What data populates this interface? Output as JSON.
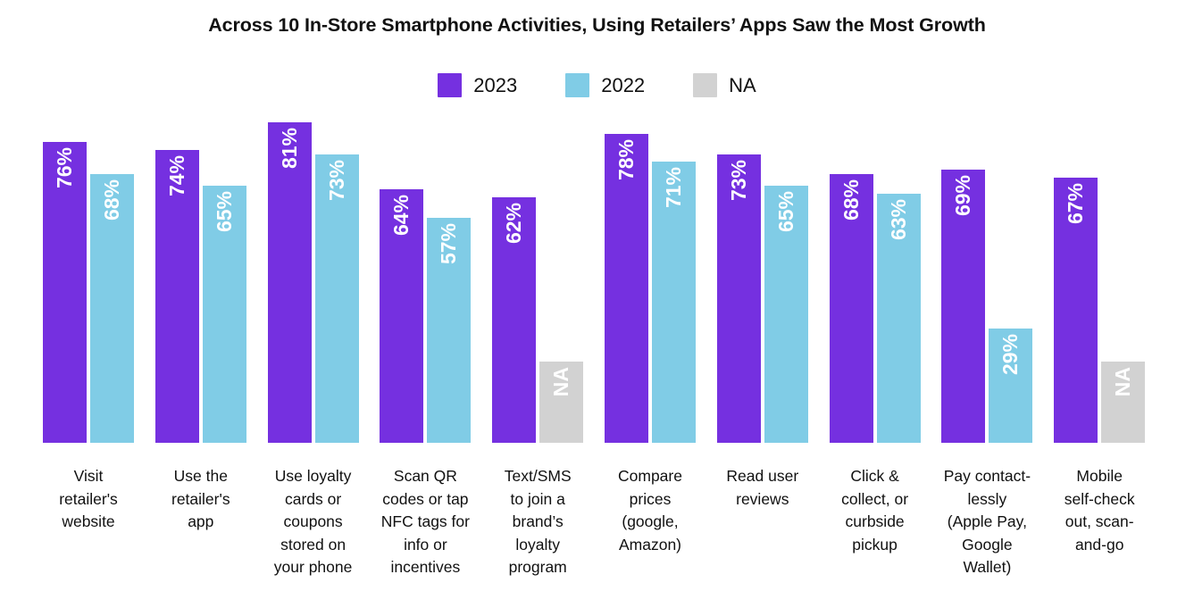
{
  "chart_data": {
    "type": "bar",
    "title": "Across 10 In-Store Smartphone Activities, Using Retailers’ Apps Saw the Most Growth",
    "xlabel": "",
    "ylabel": "",
    "ylim": [
      0,
      100
    ],
    "grid": false,
    "legend_position": "top-center",
    "categories": [
      "Visit retailer's website",
      "Use the retailer's app",
      "Use loyalty cards or coupons stored on your phone",
      "Scan QR codes or tap NFC tags for info or incentives",
      "Text/SMS to join a brand’s loyalty program",
      "Compare prices (google, Amazon)",
      "Read user reviews",
      "Click & collect, or curbside pickup",
      "Pay contact-lessly (Apple Pay, Google Wallet)",
      "Mobile self-check out, scan-and-go"
    ],
    "category_lines": [
      [
        "Visit",
        "retailer's",
        "website"
      ],
      [
        "Use the",
        "retailer's",
        "app"
      ],
      [
        "Use loyalty",
        "cards or",
        "coupons",
        "stored on",
        "your phone"
      ],
      [
        "Scan QR",
        "codes or tap",
        "NFC tags for",
        "info or",
        "incentives"
      ],
      [
        "Text/SMS",
        "to join a",
        "brand’s",
        "loyalty",
        "program"
      ],
      [
        "Compare",
        "prices",
        "(google,",
        "Amazon)"
      ],
      [
        "Read user",
        "reviews"
      ],
      [
        "Click &",
        "collect, or",
        "curbside",
        "pickup"
      ],
      [
        "Pay contact-",
        "lessly",
        "(Apple Pay,",
        "Google",
        "Wallet)"
      ],
      [
        "Mobile",
        "self-check",
        "out, scan-",
        "and-go"
      ]
    ],
    "series": [
      {
        "name": "2023",
        "color": "#7530e0",
        "values": [
          76,
          74,
          81,
          64,
          62,
          78,
          73,
          68,
          69,
          67
        ],
        "labels": [
          "76%",
          "74%",
          "81%",
          "64%",
          "62%",
          "78%",
          "73%",
          "68%",
          "69%",
          "67%"
        ]
      },
      {
        "name": "2022",
        "color": "#80cce6",
        "values": [
          68,
          65,
          73,
          57,
          null,
          71,
          65,
          63,
          29,
          null
        ],
        "labels": [
          "68%",
          "65%",
          "73%",
          "57%",
          null,
          "71%",
          "65%",
          "63%",
          "29%",
          null
        ]
      },
      {
        "name": "NA",
        "color": "#d2d2d2",
        "values": [
          null,
          null,
          null,
          null,
          20.5,
          null,
          null,
          null,
          null,
          20.5
        ],
        "labels": [
          null,
          null,
          null,
          null,
          "NA",
          null,
          null,
          null,
          null,
          "NA"
        ]
      }
    ]
  },
  "legend": {
    "items": [
      {
        "label": "2023",
        "color": "#7530e0"
      },
      {
        "label": "2022",
        "color": "#80cce6"
      },
      {
        "label": "NA",
        "color": "#d2d2d2"
      }
    ]
  }
}
